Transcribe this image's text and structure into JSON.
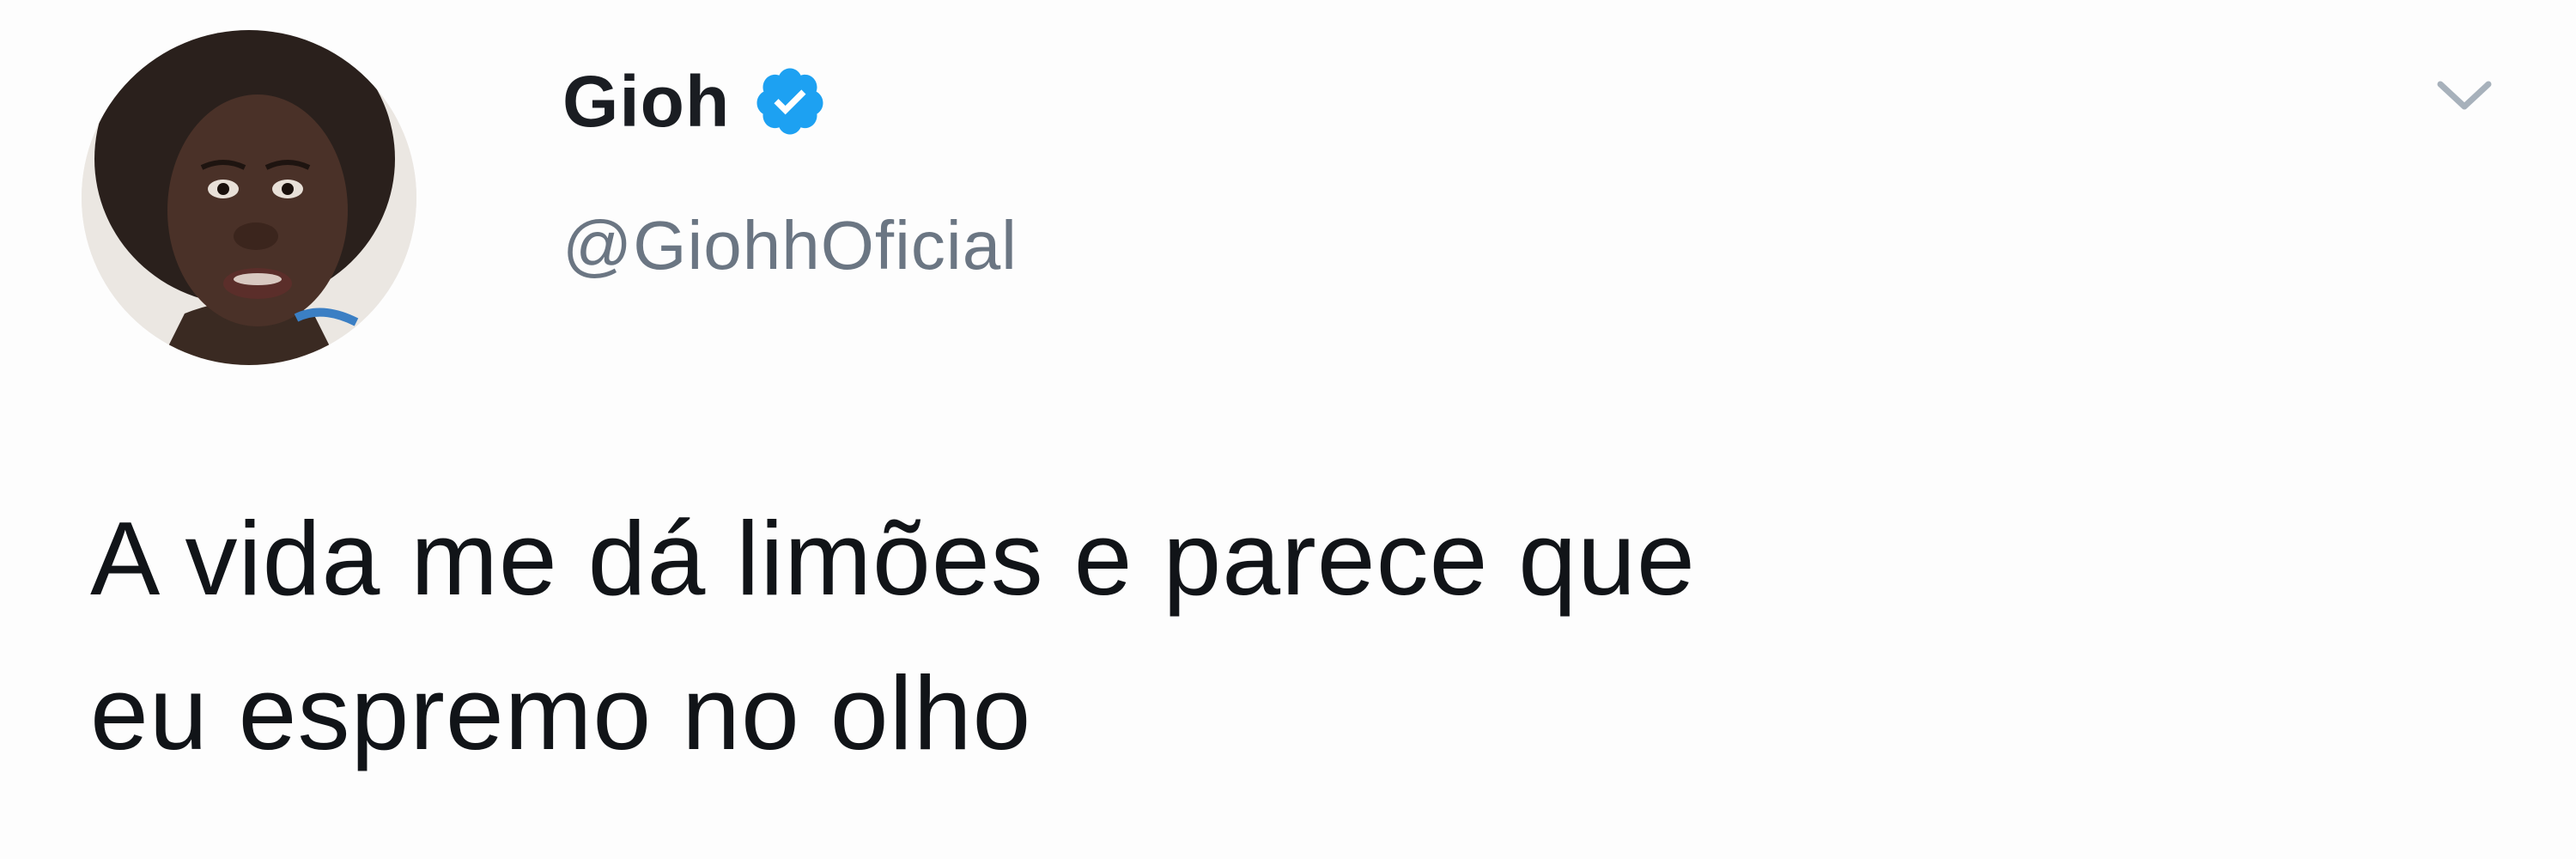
{
  "tweet": {
    "display_name": "Gioh",
    "handle": "@GiohhOficial",
    "text": "A vida me dá limões e parece que\neu espremo no olho",
    "verified": true,
    "icons": {
      "verified": "verified-badge-icon",
      "menu": "chevron-down-icon"
    },
    "colors": {
      "verified_blue": "#1da1f2",
      "handle_gray": "#6b7683",
      "text_dark": "#111418",
      "background": "#fdfdfd"
    }
  }
}
